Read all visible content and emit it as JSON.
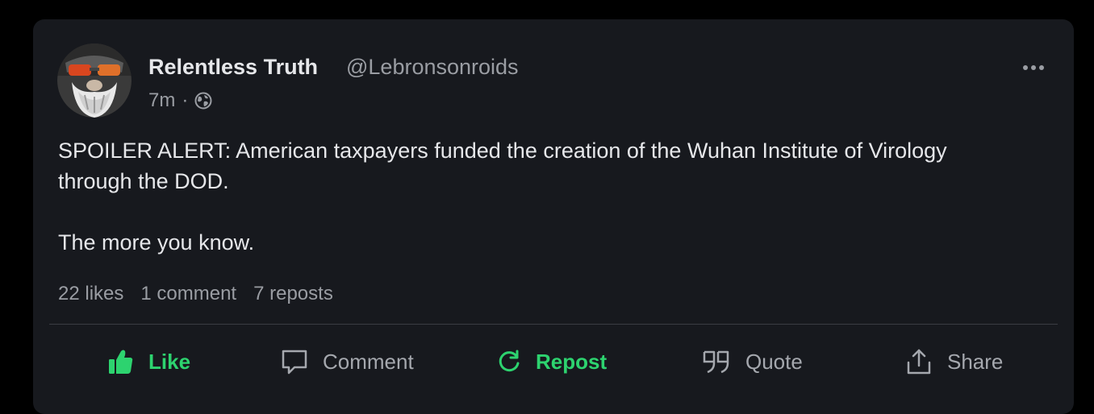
{
  "post": {
    "author_name": "Relentless Truth",
    "author_handle": "@Lebronsonroids",
    "time": "7m",
    "separator": "·",
    "visibility_icon": "globe-icon",
    "text_paragraphs": [
      "SPOILER ALERT: American taxpayers funded the creation of the Wuhan Institute of Virology through the DOD.",
      "The more you know."
    ]
  },
  "stats": {
    "likes": "22 likes",
    "comments": "1 comment",
    "reposts": "7 reposts"
  },
  "actions": {
    "like": "Like",
    "comment": "Comment",
    "repost": "Repost",
    "quote": "Quote",
    "share": "Share"
  },
  "colors": {
    "background": "#000000",
    "card": "#17191e",
    "accent": "#2dd36f",
    "primary_text": "#e6e7ea",
    "secondary_text": "#9a9da3"
  }
}
